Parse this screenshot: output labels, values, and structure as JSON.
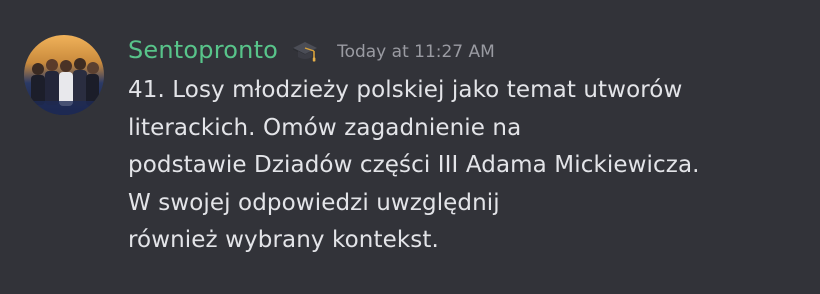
{
  "message": {
    "username": "Sentopronto",
    "role_icon": "graduation-cap-icon",
    "timestamp": "Today at 11:27 AM",
    "content_lines": [
      "41. Losy młodzieży polskiej jako temat utworów",
      "literackich. Omów zagadnienie na",
      "podstawie Dziadów części III Adama Mickiewicza.",
      "W swojej odpowiedzi uwzględnij",
      "również wybrany kontekst."
    ]
  },
  "colors": {
    "background": "#323339",
    "username": "#58c48a",
    "timestamp": "#9a9ba2",
    "text": "#e3e4e8"
  }
}
